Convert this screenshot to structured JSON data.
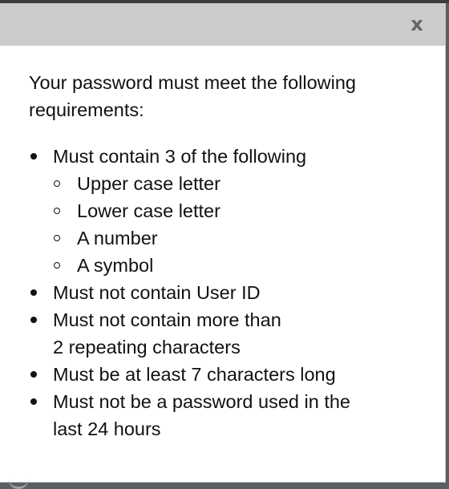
{
  "dialog": {
    "close_label": "x",
    "intro": "Your password must meet the following requirements:",
    "requirements": [
      {
        "label": "Must contain 3 of the following",
        "sub_items": [
          "Upper case letter",
          "Lower case letter",
          "A number",
          "A symbol"
        ]
      },
      {
        "label": "Must not contain User ID"
      },
      {
        "label_lines": [
          "Must not contain more than",
          "2 repeating characters"
        ]
      },
      {
        "label": "Must be at least 7 characters long"
      },
      {
        "label_lines": [
          "Must not be a password used in the",
          "last 24 hours"
        ]
      }
    ]
  },
  "colors": {
    "titlebar": "#cccccc",
    "close_icon": "#666666",
    "text": "#111111",
    "backdrop": "#5c5f61"
  }
}
